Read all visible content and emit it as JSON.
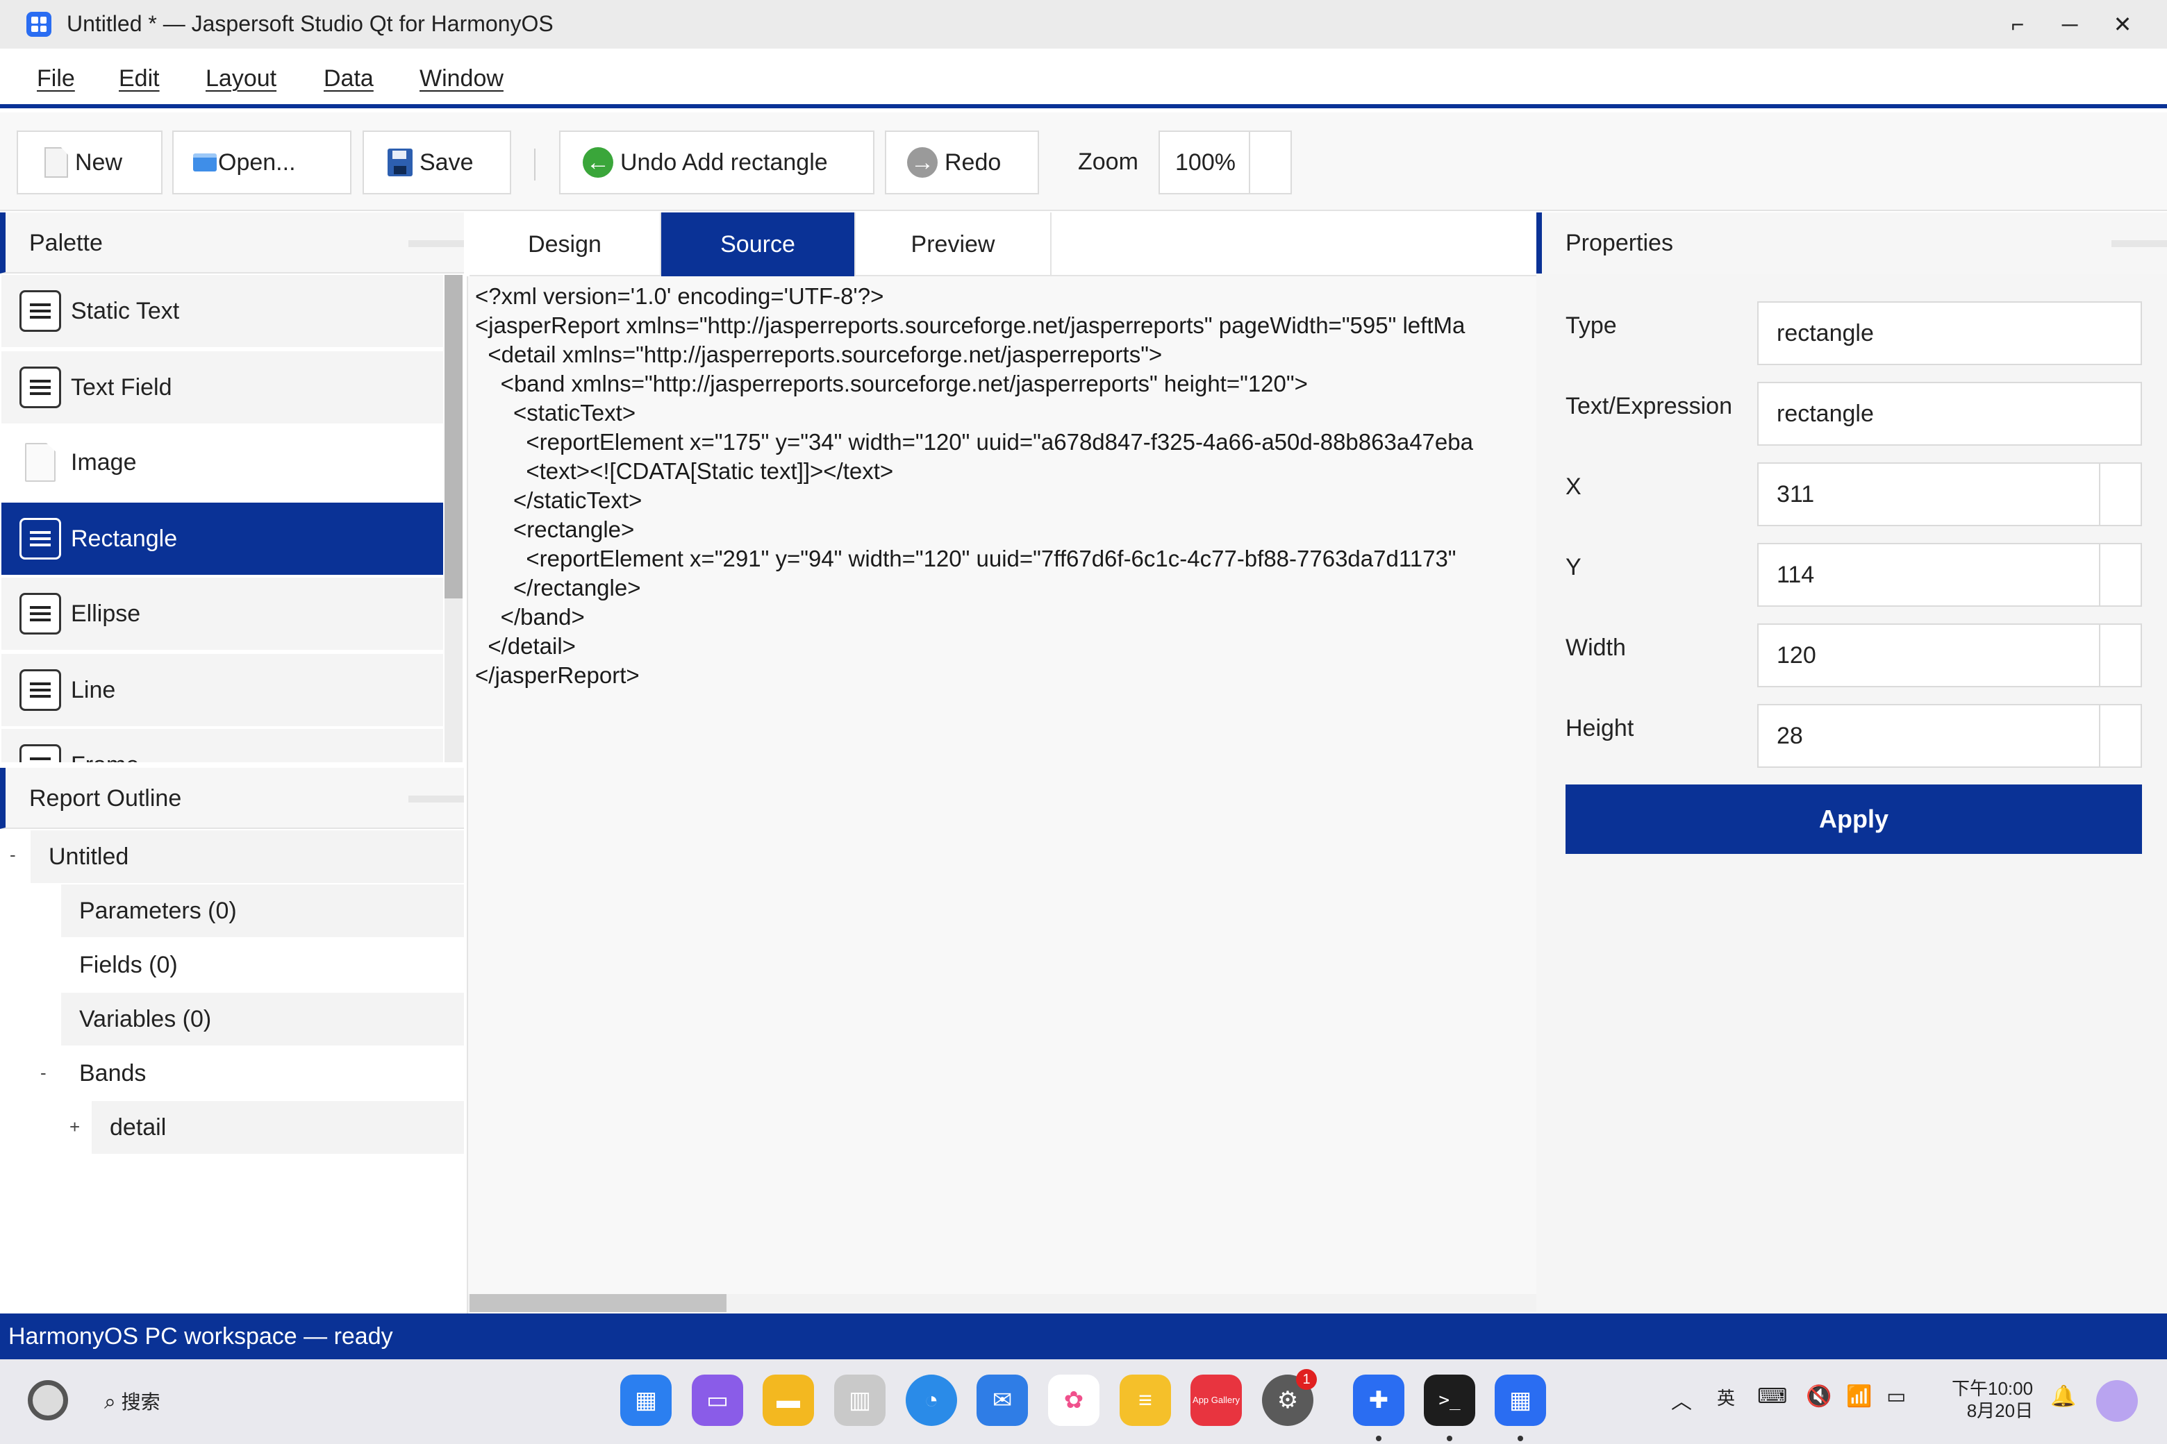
{
  "window": {
    "title": "Untitled * — Jaspersoft Studio Qt for HarmonyOS",
    "controls": {
      "restore": "⌐",
      "minimize": "─",
      "close": "✕"
    }
  },
  "menu": [
    "File",
    "Edit",
    "Layout",
    "Data",
    "Window"
  ],
  "toolbar": {
    "new_label": "New",
    "open_label": "Open...",
    "save_label": "Save",
    "undo_label": "Undo Add rectangle",
    "redo_label": "Redo",
    "zoom_label": "Zoom",
    "zoom_value": "100%"
  },
  "palette": {
    "title": "Palette",
    "items": [
      "Static Text",
      "Text Field",
      "Image",
      "Rectangle",
      "Ellipse",
      "Line",
      "Frame"
    ],
    "selected": "Rectangle"
  },
  "outline": {
    "title": "Report Outline",
    "root": "Untitled",
    "root_toggle": "-",
    "children": [
      "Parameters (0)",
      "Fields (0)",
      "Variables (0)"
    ],
    "bands_label": "Bands",
    "bands_toggle": "-",
    "detail_label": "detail",
    "detail_toggle": "+"
  },
  "editor": {
    "tabs": [
      "Design",
      "Source",
      "Preview"
    ],
    "active_tab": "Source",
    "lines": [
      "<?xml version='1.0' encoding='UTF-8'?>",
      "<jasperReport xmlns=\"http://jasperreports.sourceforge.net/jasperreports\" pageWidth=\"595\" leftMa",
      "  <detail xmlns=\"http://jasperreports.sourceforge.net/jasperreports\">",
      "    <band xmlns=\"http://jasperreports.sourceforge.net/jasperreports\" height=\"120\">",
      "      <staticText>",
      "        <reportElement x=\"175\" y=\"34\" width=\"120\" uuid=\"a678d847-f325-4a66-a50d-88b863a47eba",
      "        <text><![CDATA[Static text]]></text>",
      "      </staticText>",
      "      <rectangle>",
      "        <reportElement x=\"291\" y=\"94\" width=\"120\" uuid=\"7ff67d6f-6c1c-4c77-bf88-7763da7d1173\"",
      "      </rectangle>",
      "    </band>",
      "  </detail>",
      "</jasperReport>"
    ]
  },
  "properties": {
    "title": "Properties",
    "type_label": "Type",
    "type_value": "rectangle",
    "text_label": "Text/Expression",
    "text_value": "rectangle",
    "x_label": "X",
    "x_value": "311",
    "y_label": "Y",
    "y_value": "114",
    "width_label": "Width",
    "width_value": "120",
    "height_label": "Height",
    "height_value": "28",
    "apply_label": "Apply"
  },
  "status": "HarmonyOS PC workspace — ready",
  "taskbar": {
    "search_label": "搜索",
    "appgallery_label": "App Gallery",
    "settings_badge": "1",
    "ime_label": "英",
    "time": "下午10:00",
    "date": "8月20日"
  },
  "colors": {
    "accent": "#0a3296",
    "background": "#ffffff",
    "panel": "#f5f5f5"
  }
}
